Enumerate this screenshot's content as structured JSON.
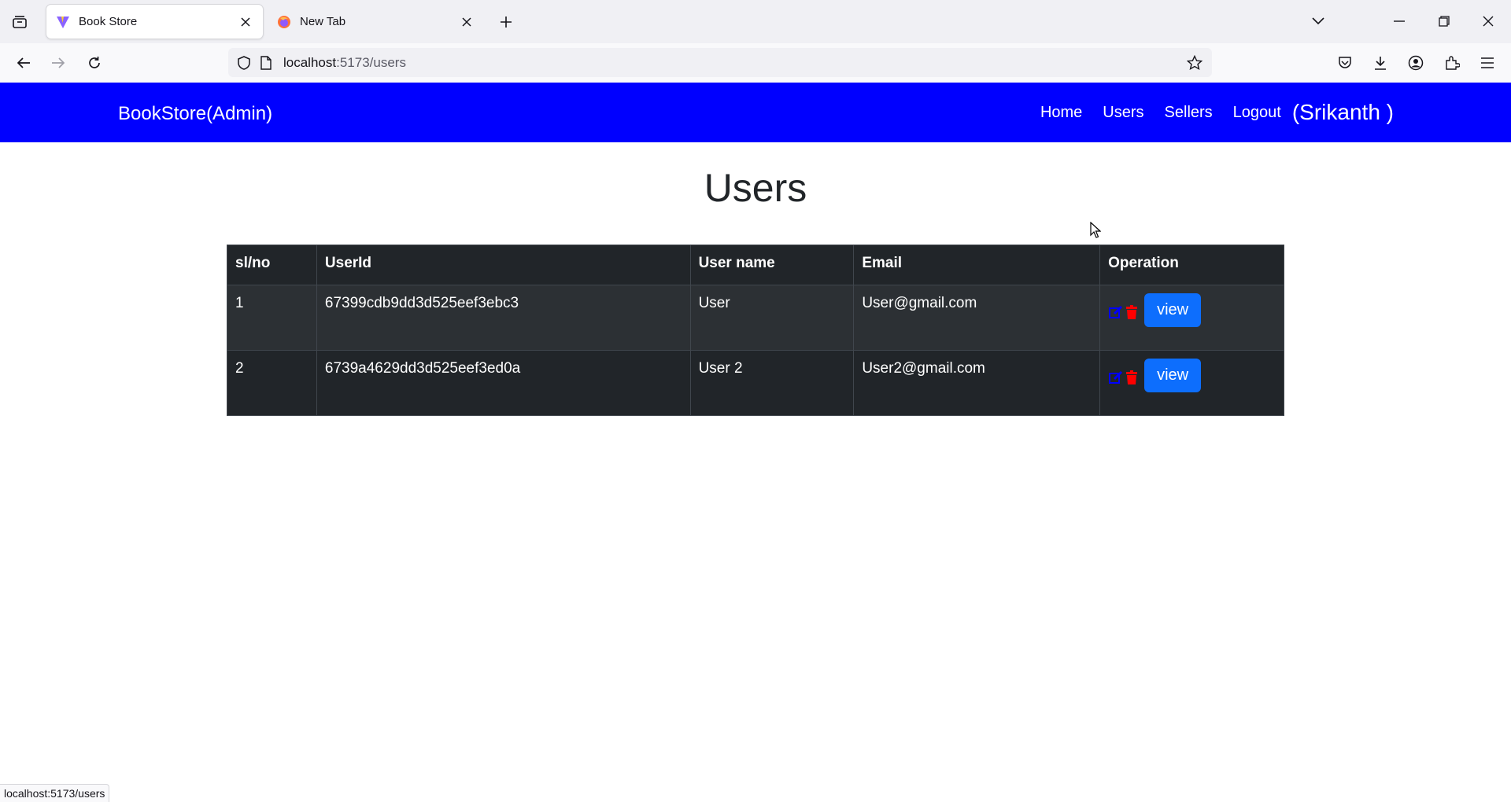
{
  "browser": {
    "tabs": [
      {
        "title": "Book Store",
        "active": true
      },
      {
        "title": "New Tab",
        "active": false
      }
    ],
    "url": {
      "host": "localhost",
      "rest": ":5173/users"
    },
    "status_text": "localhost:5173/users"
  },
  "app": {
    "brand": "BookStore(Admin)",
    "nav": {
      "home": "Home",
      "users": "Users",
      "sellers": "Sellers",
      "logout": "Logout"
    },
    "user_display": "(Srikanth )",
    "header_color": "#0000ff"
  },
  "page": {
    "title": "Users",
    "table": {
      "headers": [
        "sl/no",
        "UserId",
        "User name",
        "Email",
        "Operation"
      ],
      "rows": [
        {
          "sl": "1",
          "id": "67399cdb9dd3d525eef3ebc3",
          "name": "User",
          "email": "User@gmail.com",
          "view_label": "view"
        },
        {
          "sl": "2",
          "id": "6739a4629dd3d525eef3ed0a",
          "name": "User 2",
          "email": "User2@gmail.com",
          "view_label": "view"
        }
      ]
    }
  },
  "icons": {
    "edit": "edit-icon",
    "delete": "trash-icon"
  }
}
